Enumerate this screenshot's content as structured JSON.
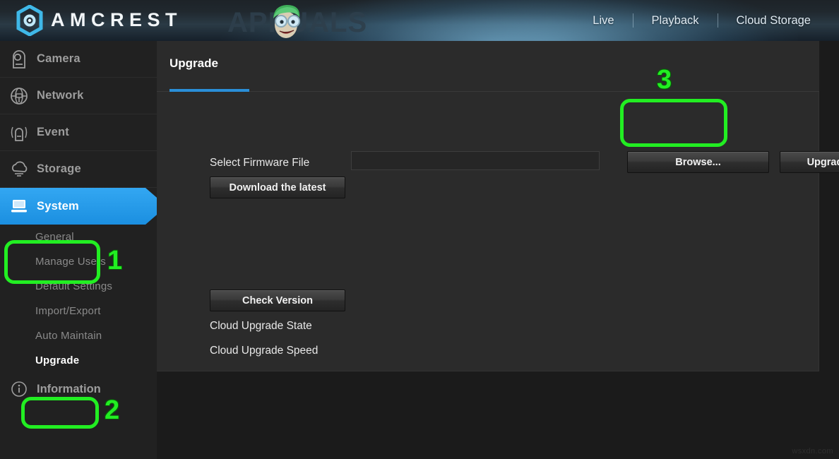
{
  "header": {
    "brand": "AMCREST",
    "brand_logo_icon": "amcrest-hexagon-icon",
    "overlay_logo": "APPUALS",
    "overlay_logo_icon": "appuals-mascot-icon",
    "nav": [
      {
        "label": "Live"
      },
      {
        "label": "Playback"
      },
      {
        "label": "Cloud Storage"
      }
    ]
  },
  "sidebar": {
    "items": [
      {
        "label": "Camera",
        "icon": "camera-icon",
        "active": false
      },
      {
        "label": "Network",
        "icon": "network-globe-icon",
        "active": false
      },
      {
        "label": "Event",
        "icon": "event-alarm-icon",
        "active": false
      },
      {
        "label": "Storage",
        "icon": "storage-cloud-icon",
        "active": false
      },
      {
        "label": "System",
        "icon": "system-monitor-icon",
        "active": true
      }
    ],
    "subitems": [
      {
        "label": "General",
        "current": false
      },
      {
        "label": "Manage Users",
        "current": false
      },
      {
        "label": "Default Settings",
        "current": false
      },
      {
        "label": "Import/Export",
        "current": false
      },
      {
        "label": "Auto Maintain",
        "current": false
      },
      {
        "label": "Upgrade",
        "current": true
      }
    ],
    "information": {
      "label": "Information",
      "icon": "info-circle-icon"
    }
  },
  "main": {
    "tab": "Upgrade",
    "firmware_label": "Select Firmware File",
    "firmware_value": "",
    "firmware_placeholder": "",
    "download_button": "Download the latest",
    "browse_button": "Browse...",
    "upgrade_button": "Upgrade",
    "check_version_button": "Check Version",
    "cloud_upgrade_state_label": "Cloud Upgrade State",
    "cloud_upgrade_state_value": "",
    "cloud_upgrade_speed_label": "Cloud Upgrade Speed",
    "cloud_upgrade_speed_value": ""
  },
  "annotations": {
    "color": "#22ee22",
    "steps": [
      {
        "number": "1",
        "target": "System sidebar item"
      },
      {
        "number": "2",
        "target": "Upgrade submenu item"
      },
      {
        "number": "3",
        "target": "Browse... button"
      }
    ]
  },
  "watermark": "wsxdn.com"
}
